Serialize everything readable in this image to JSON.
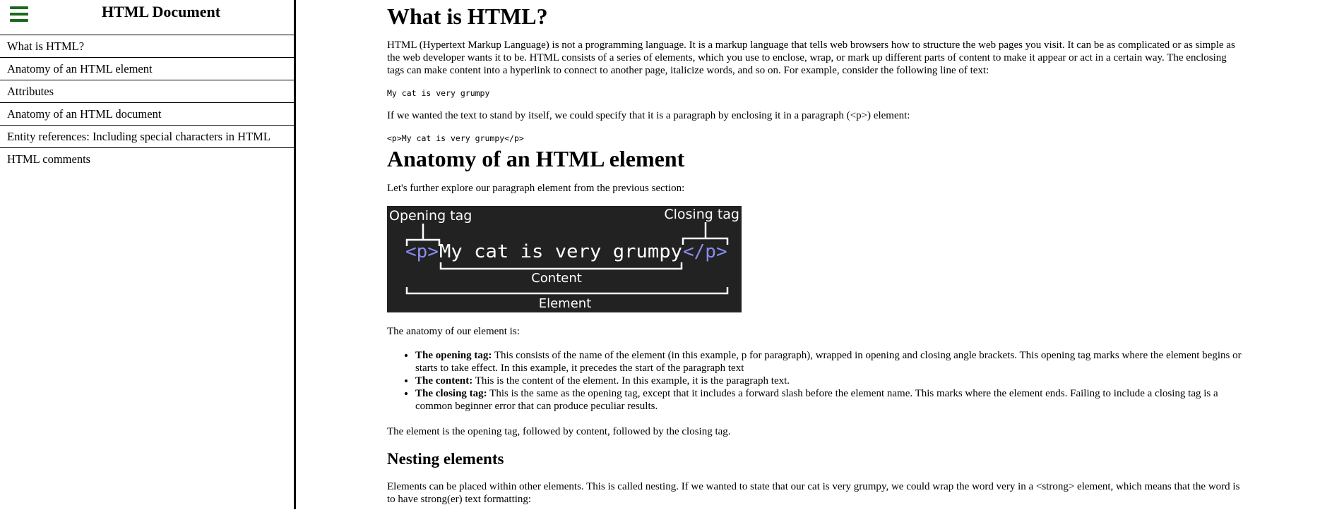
{
  "sidebar": {
    "title": "HTML Document",
    "items": [
      {
        "label": "What is HTML?"
      },
      {
        "label": "Anatomy of an HTML element"
      },
      {
        "label": "Attributes"
      },
      {
        "label": "Anatomy of an HTML document"
      },
      {
        "label": "Entity references: Including special characters in HTML"
      },
      {
        "label": "HTML comments"
      }
    ]
  },
  "main": {
    "h1_what": "What is HTML?",
    "p_intro": "HTML (Hypertext Markup Language) is not a programming language. It is a markup language that tells web browsers how to structure the web pages you visit. It can be as complicated or as simple as the web developer wants it to be. HTML consists of a series of elements, which you use to enclose, wrap, or mark up different parts of content to make it appear or act in a certain way. The enclosing tags can make content into a hyperlink to connect to another page, italicize words, and so on. For example, consider the following line of text:",
    "code1": "My cat is very grumpy",
    "p_paragraph": "If we wanted the text to stand by itself, we could specify that it is a paragraph by enclosing it in a paragraph (<p>) element:",
    "code2": "<p>My cat is very grumpy</p>",
    "h1_anatomy": "Anatomy of an HTML element",
    "p_explore": "Let's further explore our paragraph element from the previous section:",
    "figure": {
      "opening_tag_label": "Opening tag",
      "closing_tag_label": "Closing tag",
      "open_tag": "<p>",
      "content": "My cat is very grumpy",
      "close_tag": "</p>",
      "content_label": "Content",
      "element_label": "Element",
      "bg_color": "#222222",
      "tag_color": "#8a8cf0",
      "text_color": "#ffffff"
    },
    "p_anatomy": "The anatomy of our element is:",
    "bullets": [
      {
        "term": "The opening tag:",
        "text": " This consists of the name of the element (in this example, p for paragraph), wrapped in opening and closing angle brackets. This opening tag marks where the element begins or starts to take effect. In this example, it precedes the start of the paragraph text"
      },
      {
        "term": "The content:",
        "text": " This is the content of the element. In this example, it is the paragraph text."
      },
      {
        "term": "The closing tag:",
        "text": " This is the same as the opening tag, except that it includes a forward slash before the element name. This marks where the element ends. Failing to include a closing tag is a common beginner error that can produce peculiar results."
      }
    ],
    "p_element": "The element is the opening tag, followed by content, followed by the closing tag.",
    "h2_nesting": "Nesting elements",
    "p_nesting": "Elements can be placed within other elements. This is called nesting. If we wanted to state that our cat is very grumpy, we could wrap the word very in a <strong> element, which means that the word is to have strong(er) text formatting:"
  },
  "colors": {
    "menu_icon": "#1b6a1b"
  }
}
